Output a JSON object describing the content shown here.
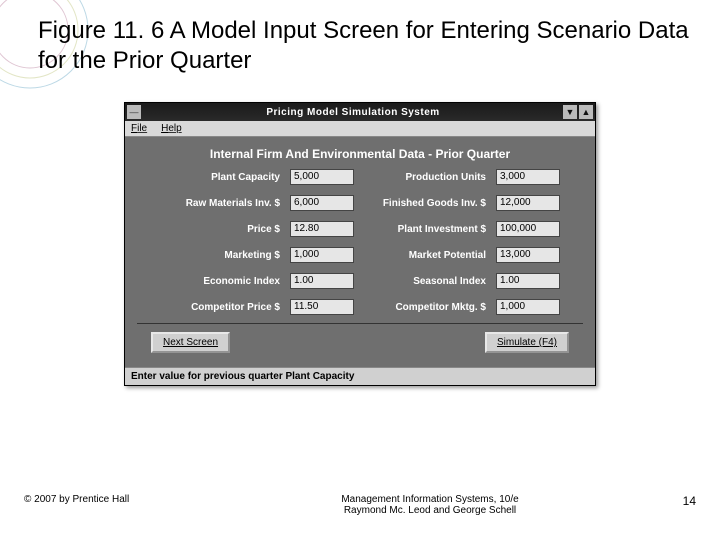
{
  "slide": {
    "title": "Figure 11. 6 A Model Input Screen for Entering Scenario Data for the Prior Quarter"
  },
  "window": {
    "title": "Pricing Model Simulation System",
    "menu": {
      "file": "File",
      "help": "Help"
    },
    "panel_title": "Internal Firm And Environmental Data - Prior Quarter",
    "fields": {
      "plant_capacity": {
        "label": "Plant Capacity",
        "value": "5,000"
      },
      "production_units": {
        "label": "Production Units",
        "value": "3,000"
      },
      "raw_materials": {
        "label": "Raw Materials Inv. $",
        "value": "6,000"
      },
      "finished_goods": {
        "label": "Finished Goods Inv. $",
        "value": "12,000"
      },
      "price": {
        "label": "Price $",
        "value": "12.80"
      },
      "plant_investment": {
        "label": "Plant Investment $",
        "value": "100,000"
      },
      "marketing": {
        "label": "Marketing $",
        "value": "1,000"
      },
      "market_potential": {
        "label": "Market Potential",
        "value": "13,000"
      },
      "economic_index": {
        "label": "Economic Index",
        "value": "1.00"
      },
      "seasonal_index": {
        "label": "Seasonal Index",
        "value": "1.00"
      },
      "competitor_price": {
        "label": "Competitor Price $",
        "value": "11.50"
      },
      "competitor_mktg": {
        "label": "Competitor Mktg. $",
        "value": "1,000"
      }
    },
    "buttons": {
      "next": "Next Screen",
      "simulate": "Simulate (F4)"
    },
    "status": "Enter value for previous quarter Plant Capacity"
  },
  "footer": {
    "copyright": "© 2007 by Prentice Hall",
    "center1": "Management Information Systems, 10/e",
    "center2": "Raymond Mc. Leod and George Schell",
    "pagenum": "14"
  }
}
